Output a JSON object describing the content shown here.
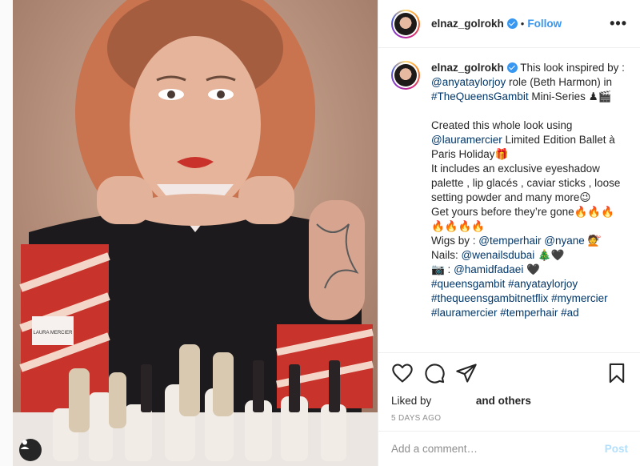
{
  "post": {
    "photo_label": "LAURA MERCIER",
    "author": {
      "username": "elnaz_golrokh",
      "verified_icon": "verified-badge-icon"
    },
    "header": {
      "separator": "•",
      "follow_label": "Follow",
      "more_icon": "•••"
    },
    "caption": {
      "username": "elnaz_golrokh",
      "text_1": " This look inspired by : ",
      "mention_1": "@anyataylorjoy",
      "text_2": " role (Beth Harmon) in ",
      "hashtag_1": "#TheQueensGambit",
      "text_3": " Mini-Series ♟🎬\n\nCreated this whole look using ",
      "mention_2": "@lauramercier",
      "text_4": " Limited Edition Ballet à Paris Holiday🎁\nIt includes an exclusive eyeshadow palette , lip glacés , caviar sticks , loose setting powder and many more😉\nGet yours before they’re gone🔥🔥🔥 🔥🔥🔥🔥\nWigs by : ",
      "mention_3": "@temperhair",
      "text_5": " ",
      "mention_4": "@nyane",
      "text_6": " 💇\nNails: ",
      "mention_5": "@wenailsdubai",
      "text_7": " 🎄🖤\n📷 : ",
      "mention_6": "@hamidfadaei",
      "text_8": " 🖤\n",
      "hashtags": "#queensgambit #anyataylorjoy #thequeensgambitnetflix #mymercier #lauramercier #temperhair #ad"
    },
    "likes": {
      "prefix": "Liked by",
      "suffix": "and others"
    },
    "timestamp": "5 DAYS AGO",
    "comment_box": {
      "placeholder": "Add a comment…",
      "post_label": "Post"
    }
  },
  "icons": {
    "like": "heart-icon",
    "comment": "comment-icon",
    "share": "share-icon",
    "save": "bookmark-icon",
    "user": "user-tag-icon"
  },
  "colors": {
    "link": "#00376b",
    "follow": "#3897f0",
    "post_disabled": "#b2dffc",
    "muted": "#8e8e8e"
  }
}
